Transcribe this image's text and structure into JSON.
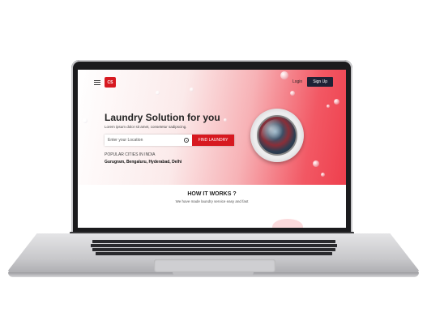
{
  "nav": {
    "logo_text": "CS",
    "login_label": "Login",
    "signup_label": "Sign Up"
  },
  "hero": {
    "title": "Laundry Solution for you",
    "subtitle": "Lorem ipsum dolor sit amet, consetetur sadipscing.",
    "search": {
      "placeholder": "Enter your Location",
      "button_label": "FIND LAUNDRY"
    },
    "cities_label": "POPULAR CITIES IN INDIA",
    "cities": "Gurugram, Bengaluru, Hyderabad, Delhi"
  },
  "how": {
    "title": "HOW IT WORKS ?",
    "subtitle": "We have made laundry service easy and fast"
  },
  "colors": {
    "accent": "#d71920",
    "dark_button": "#1e2235",
    "hero_gradient_end": "#ee3f4d"
  },
  "icons": [
    "hamburger-icon",
    "location-target-icon",
    "washing-machine-image"
  ]
}
